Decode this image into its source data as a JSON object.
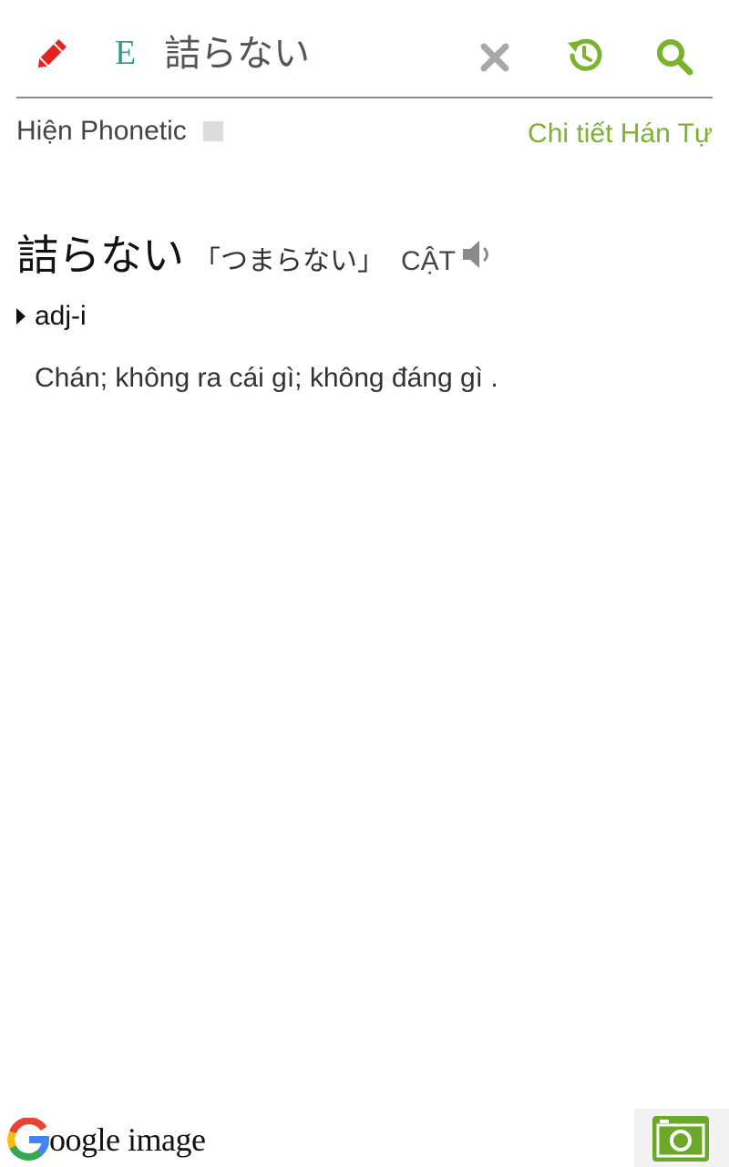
{
  "search": {
    "lang_badge": "E",
    "query": "詰らない"
  },
  "options": {
    "phonetic_label": "Hiện Phonetic",
    "phonetic_checked": false,
    "kanji_detail_link": "Chi tiết Hán Tự"
  },
  "entry": {
    "word": "詰らない",
    "reading": "「つまらない」",
    "han_viet": "CẬT",
    "part_of_speech": "adj-i",
    "meaning": "Chán; không ra cái gì; không đáng gì ."
  },
  "footer": {
    "google_text": "oogle image"
  },
  "colors": {
    "accent_green": "#7bb32e",
    "pencil_red": "#e8231f",
    "badge_teal": "#2e9e8a"
  },
  "icons": [
    "pencil-icon",
    "clear-icon",
    "history-icon",
    "search-icon",
    "speaker-icon",
    "camera-icon",
    "google-g-icon"
  ]
}
